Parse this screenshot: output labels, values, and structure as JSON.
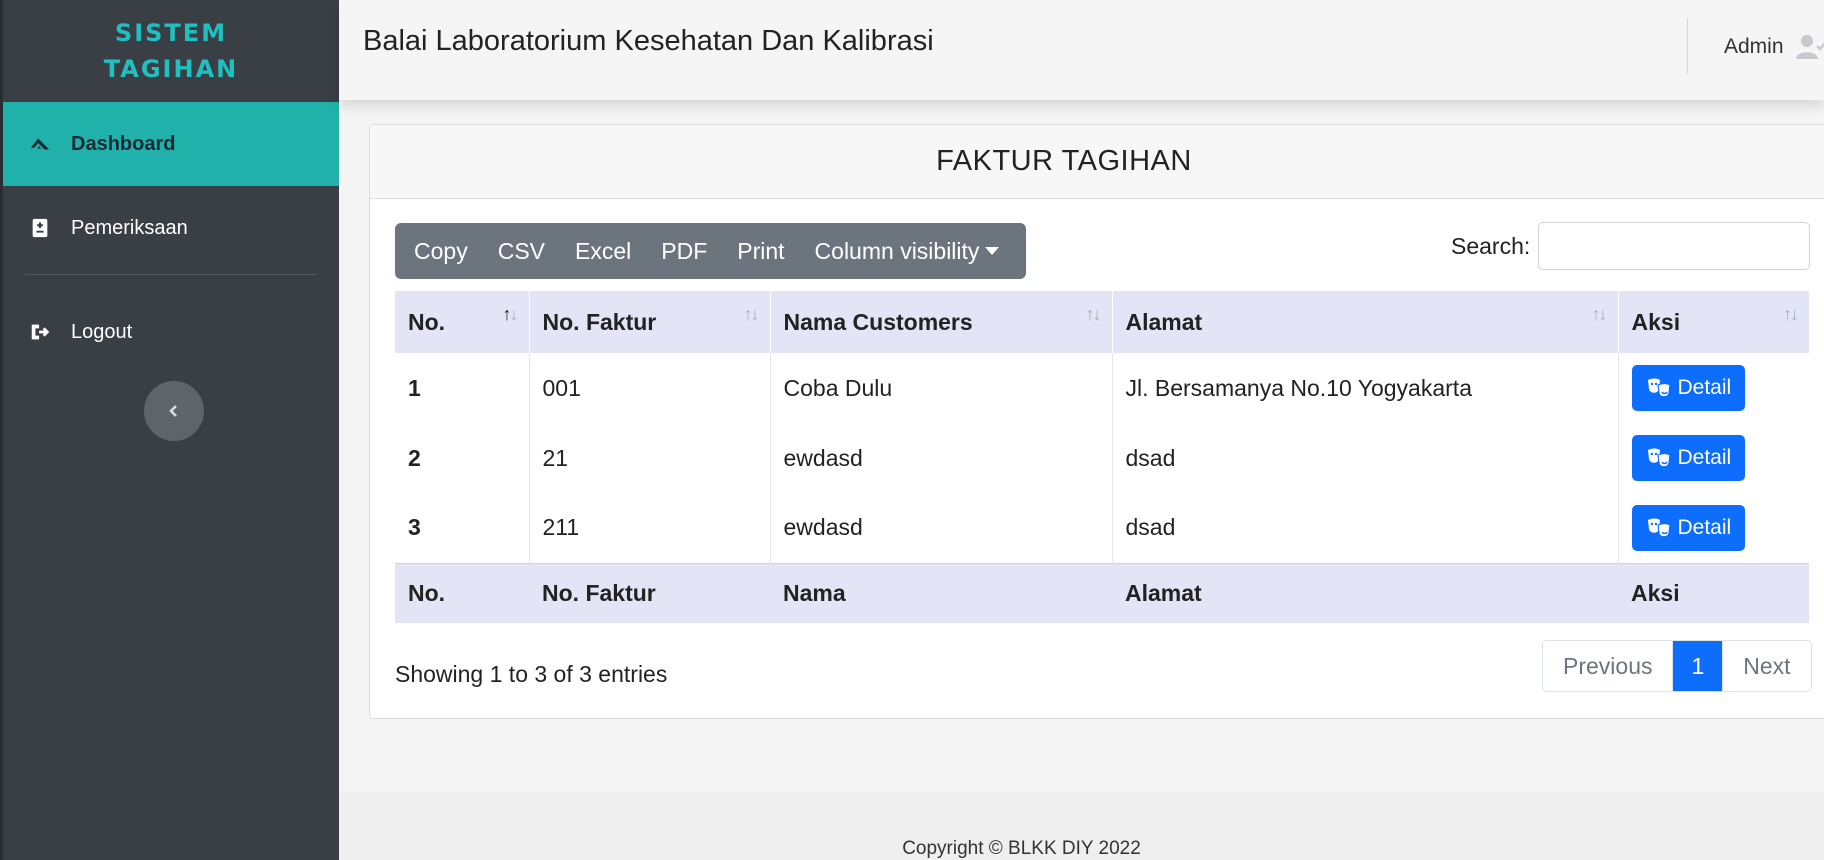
{
  "brand": {
    "name": "SISTEM TAGIHAN"
  },
  "sidebar": {
    "items": [
      {
        "label": "Dashboard",
        "icon": "logo-icon",
        "active": true
      },
      {
        "label": "Pemeriksaan",
        "icon": "medical-file-icon",
        "active": false
      },
      {
        "label": "Logout",
        "icon": "logout-icon",
        "active": false
      }
    ]
  },
  "header": {
    "title": "Balai Laboratorium Kesehatan Dan Kalibrasi",
    "user": "Admin"
  },
  "card": {
    "title": "FAKTUR TAGIHAN"
  },
  "toolbar": {
    "buttons": [
      "Copy",
      "CSV",
      "Excel",
      "PDF",
      "Print",
      "Column visibility"
    ]
  },
  "search": {
    "label": "Search:",
    "value": ""
  },
  "table": {
    "headers": [
      "No.",
      "No. Faktur",
      "Nama Customers",
      "Alamat",
      "Aksi"
    ],
    "footers": [
      "No.",
      "No. Faktur",
      "Nama",
      "Alamat",
      "Aksi"
    ],
    "rows": [
      {
        "no": "1",
        "faktur": "001",
        "nama": "Coba Dulu",
        "alamat": "Jl. Bersamanya No.10 Yogyakarta",
        "aksi": "Detail"
      },
      {
        "no": "2",
        "faktur": "21",
        "nama": "ewdasd",
        "alamat": "dsad",
        "aksi": "Detail"
      },
      {
        "no": "3",
        "faktur": "211",
        "nama": "ewdasd",
        "alamat": "dsad",
        "aksi": "Detail"
      }
    ]
  },
  "info": "Showing 1 to 3 of 3 entries",
  "pagination": {
    "previous": "Previous",
    "current": "1",
    "next": "Next"
  },
  "footer": {
    "text": "Copyright © BLKK DIY 2022"
  },
  "colors": {
    "accent": "#20b2aa",
    "brand": "#20c0c0",
    "primary": "#0d6efd",
    "sidebar": "#3a3f46"
  }
}
